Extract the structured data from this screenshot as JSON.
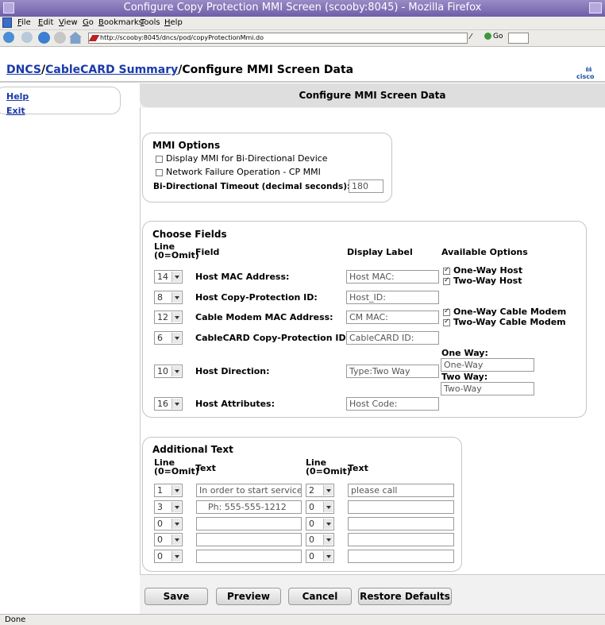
{
  "window": {
    "title": "Configure Copy Protection MMI Screen (scooby:8045) - Mozilla Firefox"
  },
  "menu": [
    "File",
    "Edit",
    "View",
    "Go",
    "Bookmarks",
    "Tools",
    "Help"
  ],
  "nav": {
    "url": "http://scooby:8045/dncs/pod/copyProtectionMmi.do",
    "go_label": "Go"
  },
  "breadcrumb": {
    "part1": "DNCS",
    "sep1": "/",
    "part2": "CableCARD Summary",
    "sep2": "/",
    "current": "Configure MMI Screen Data"
  },
  "logo": {
    "bars": "ılıılı",
    "text": "cisco"
  },
  "sidebar": {
    "help": "Help",
    "exit": "Exit"
  },
  "page_title": "Configure MMI Screen Data",
  "mmi_options": {
    "legend": "MMI Options",
    "display_mmi": {
      "label": "Display MMI for Bi-Directional Device",
      "checked": false
    },
    "network_failure": {
      "label": "Network Failure Operation - CP MMI",
      "checked": false
    },
    "timeout_label": "Bi-Directional Timeout (decimal seconds):",
    "timeout_value": "180"
  },
  "choose_fields": {
    "legend": "Choose Fields",
    "col_line": "Line",
    "col_line_sub": "(0=Omit)",
    "col_field": "Field",
    "col_display": "Display Label",
    "col_options": "Available Options",
    "rows": [
      {
        "line": "14",
        "field": "Host MAC Address:",
        "display": "Host MAC:"
      },
      {
        "line": "8",
        "field": "Host Copy-Protection ID:",
        "display": "Host_ID:"
      },
      {
        "line": "12",
        "field": "Cable Modem MAC Address:",
        "display": "CM MAC:"
      },
      {
        "line": "6",
        "field": "CableCARD Copy-Protection ID:",
        "display": "CableCARD ID:"
      },
      {
        "line": "10",
        "field": "Host Direction:",
        "display": "Type:Two Way"
      },
      {
        "line": "16",
        "field": "Host Attributes:",
        "display": "Host Code:"
      }
    ],
    "options": {
      "one_way_host": "One-Way Host",
      "two_way_host": "Two-Way Host",
      "one_way_cm": "One-Way Cable Modem",
      "two_way_cm": "Two-Way Cable Modem",
      "one_way_label": "One Way:",
      "one_way_value": "One-Way",
      "two_way_label": "Two Way:",
      "two_way_value": "Two-Way"
    }
  },
  "additional_text": {
    "legend": "Additional Text",
    "col_line": "Line",
    "col_line_sub": "(0=Omit)",
    "col_text": "Text",
    "rows": [
      {
        "line1": "1",
        "text1": "In order to start service",
        "line2": "2",
        "text2": "please call"
      },
      {
        "line1": "3",
        "text1": "Ph: 555-555-1212",
        "line2": "0",
        "text2": ""
      },
      {
        "line1": "0",
        "text1": "",
        "line2": "0",
        "text2": ""
      },
      {
        "line1": "0",
        "text1": "",
        "line2": "0",
        "text2": ""
      },
      {
        "line1": "0",
        "text1": "",
        "line2": "0",
        "text2": ""
      }
    ]
  },
  "buttons": {
    "save": "Save",
    "preview": "Preview",
    "cancel": "Cancel",
    "restore": "Restore Defaults"
  },
  "status": "Done"
}
